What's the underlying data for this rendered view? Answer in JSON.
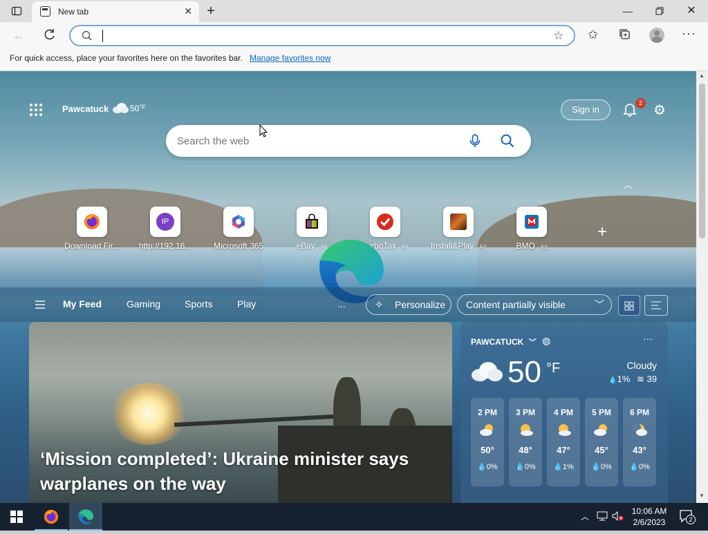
{
  "tab": {
    "title": "New tab"
  },
  "address": {
    "value": ""
  },
  "favbar": {
    "text": "For quick access, place your favorites here on the favorites bar.",
    "link": "Manage favorites now"
  },
  "header": {
    "location": "Pawcatuck",
    "temp": "50",
    "unit": "°F",
    "signin": "Sign in",
    "notif_count": "2"
  },
  "search": {
    "placeholder": "Search the web"
  },
  "tiles": [
    {
      "label": "Download Fir...",
      "ad": ""
    },
    {
      "label": "http://192.16...",
      "ad": ""
    },
    {
      "label": "Microsoft 365",
      "ad": ""
    },
    {
      "label": "eBay",
      "ad": "· Ad"
    },
    {
      "label": "TurboTax",
      "ad": "· Ad"
    },
    {
      "label": "Install&Play",
      "ad": "· Ad"
    },
    {
      "label": "BMO",
      "ad": "· Ad"
    }
  ],
  "tile_ip_text": "IP",
  "feed": {
    "items": [
      "My Feed",
      "Gaming",
      "Sports",
      "Play"
    ],
    "more": "...",
    "personalize": "Personalize",
    "content": "Content partially visible"
  },
  "news": {
    "headline": "‘Mission completed’: Ukraine minister says warplanes on the way"
  },
  "weather": {
    "location": "PAWCATUCK",
    "temp": "50",
    "unit": "°F",
    "condition": "Cloudy",
    "precip": "1%",
    "wind": "39",
    "hours": [
      {
        "time": "2 PM",
        "temp": "50°",
        "precip": "0%"
      },
      {
        "time": "3 PM",
        "temp": "48°",
        "precip": "0%"
      },
      {
        "time": "4 PM",
        "temp": "47°",
        "precip": "1%"
      },
      {
        "time": "5 PM",
        "temp": "45°",
        "precip": "0%"
      },
      {
        "time": "6 PM",
        "temp": "43°",
        "precip": "0%"
      }
    ]
  },
  "taskbar": {
    "time": "10:06 AM",
    "date": "2/6/2023",
    "notif": "2"
  }
}
